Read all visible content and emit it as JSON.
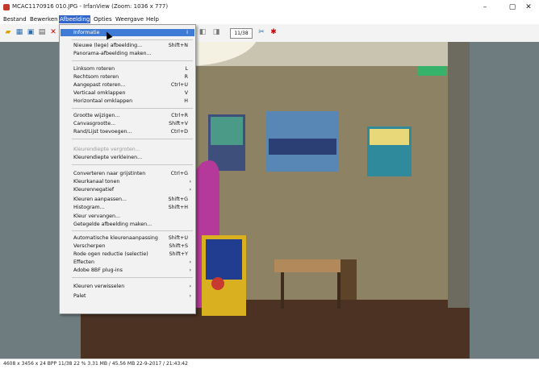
{
  "window": {
    "title": "MCAC1170916 010.JPG - IrfanView (Zoom: 1036 x 777)",
    "min": "–",
    "max": "▢",
    "close": "✕"
  },
  "menubar": [
    "Bestand",
    "Bewerken",
    "Afbeelding",
    "Opties",
    "Weergave",
    "Help"
  ],
  "toolbar": {
    "page": "11/38"
  },
  "menu": {
    "items": [
      {
        "label": "Informatie",
        "shortcut": "I",
        "highlighted": true
      },
      {
        "label": "Nieuwe (lege) afbeelding...",
        "shortcut": "Shift+N"
      },
      {
        "label": "Panorama-afbeelding maken...",
        "shortcut": ""
      },
      {
        "label": "Linksom roteren",
        "shortcut": "L"
      },
      {
        "label": "Rechtsom roteren",
        "shortcut": "R"
      },
      {
        "label": "Aangepast roteren...",
        "shortcut": "Ctrl+U"
      },
      {
        "label": "Verticaal omklappen",
        "shortcut": "V"
      },
      {
        "label": "Horizontaal omklappen",
        "shortcut": "H"
      },
      {
        "label": "Grootte wijzigen...",
        "shortcut": "Ctrl+R"
      },
      {
        "label": "Canvasgrootte...",
        "shortcut": "Shift+V"
      },
      {
        "label": "Rand/Lijst toevoegen...",
        "shortcut": "Ctrl+D"
      },
      {
        "label": "Kleurendiepte vergroten...",
        "shortcut": "",
        "disabled": true
      },
      {
        "label": "Kleurendiepte verkleinen...",
        "shortcut": ""
      },
      {
        "label": "Converteren naar grijstinten",
        "shortcut": "Ctrl+G"
      },
      {
        "label": "Kleurkanaal tonen",
        "shortcut": "",
        "submenu": true
      },
      {
        "label": "Kleurennegatief",
        "shortcut": "",
        "submenu": true
      },
      {
        "label": "Kleuren aanpassen...",
        "shortcut": "Shift+G"
      },
      {
        "label": "Histogram...",
        "shortcut": "Shift+H"
      },
      {
        "label": "Kleur vervangen...",
        "shortcut": ""
      },
      {
        "label": "Getegelde afbeelding maken...",
        "shortcut": ""
      },
      {
        "label": "Automatische kleurenaanpassing",
        "shortcut": "Shift+U"
      },
      {
        "label": "Verscherpen",
        "shortcut": "Shift+S"
      },
      {
        "label": "Rode ogen reductie (selectie)",
        "shortcut": "Shift+Y"
      },
      {
        "label": "Effecten",
        "shortcut": "",
        "submenu": true
      },
      {
        "label": "Adobe 8BF plug-ins",
        "shortcut": "",
        "submenu": true
      },
      {
        "label": "Kleuren verwisselen",
        "shortcut": "",
        "submenu": true
      },
      {
        "label": "Palet",
        "shortcut": "",
        "submenu": true
      }
    ]
  },
  "statusbar": {
    "text": "4608 x 3456 x 24 BPP   11/38   22 %   3.31 MB / 45.56 MB   22-9-2017 / 21:43:42"
  },
  "colors": {
    "highlight": "#3d7bd6",
    "viewport": "#6e7c80"
  }
}
